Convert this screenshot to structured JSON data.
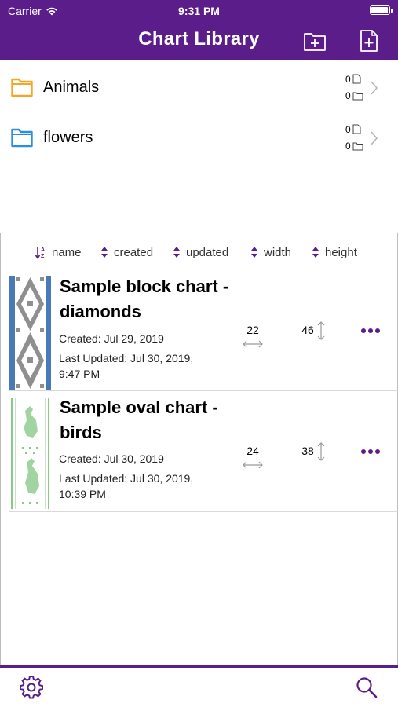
{
  "colors": {
    "accent": "#5b1d8a",
    "folder_orange": "#f5a623",
    "folder_blue": "#2d8fe0",
    "thumb_block_blue": "#4a79b8",
    "thumb_oval_green": "#8bc98a"
  },
  "status_bar": {
    "carrier": "Carrier",
    "time": "9:31 PM"
  },
  "header": {
    "title": "Chart Library",
    "new_folder_icon": "folder-plus-icon",
    "new_chart_icon": "file-plus-icon"
  },
  "folders": [
    {
      "name": "Animals",
      "file_count": "0",
      "folder_count": "0",
      "icon_color": "#f5a623"
    },
    {
      "name": "flowers",
      "file_count": "0",
      "folder_count": "0",
      "icon_color": "#2d8fe0"
    }
  ],
  "sort_options": [
    {
      "label": "name",
      "icon": "sort-az-icon"
    },
    {
      "label": "created",
      "icon": "sort-updown-icon"
    },
    {
      "label": "updated",
      "icon": "sort-updown-icon"
    },
    {
      "label": "width",
      "icon": "sort-updown-icon"
    },
    {
      "label": "height",
      "icon": "sort-updown-icon"
    }
  ],
  "charts": [
    {
      "name": "Sample block chart - diamonds",
      "created": "Created: Jul 29, 2019",
      "updated": "Last Updated: Jul 30, 2019, 9:47 PM",
      "width": "22",
      "height": "46"
    },
    {
      "name": "Sample oval chart - birds",
      "created": "Created: Jul 30, 2019",
      "updated": "Last Updated: Jul 30, 2019, 10:39 PM",
      "width": "24",
      "height": "38"
    }
  ],
  "bottom_bar": {
    "settings_icon": "gear-icon",
    "search_icon": "search-icon"
  }
}
